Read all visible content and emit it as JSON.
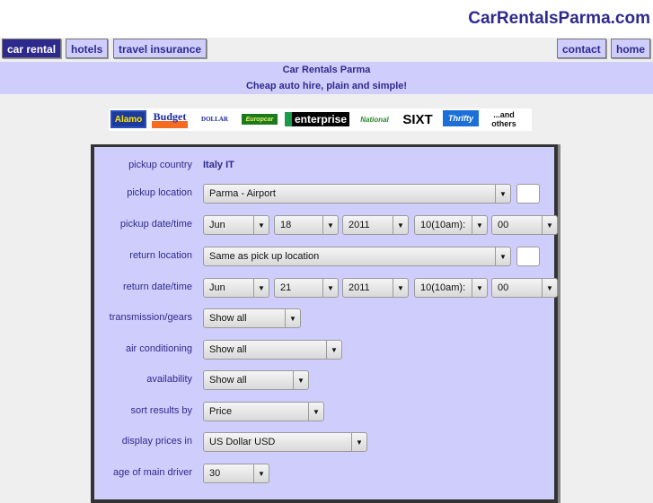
{
  "site_title": "CarRentalsParma.com",
  "nav": {
    "left": [
      {
        "label": "car rental",
        "active": true
      },
      {
        "label": "hotels",
        "active": false
      },
      {
        "label": "travel insurance",
        "active": false
      }
    ],
    "right": [
      {
        "label": "contact"
      },
      {
        "label": "home"
      }
    ]
  },
  "banner": {
    "title": "Car Rentals Parma",
    "tagline": "Cheap auto hire, plain and simple!"
  },
  "logos": [
    "Alamo",
    "Budget",
    "DOLLAR",
    "Europcar",
    "enterprise",
    "National",
    "SIXT",
    "Thrifty",
    "...and others"
  ],
  "form": {
    "pickup_country": {
      "label": "pickup country",
      "value": "Italy IT"
    },
    "pickup_location": {
      "label": "pickup location",
      "value": "Parma - Airport"
    },
    "pickup_datetime": {
      "label": "pickup date/time",
      "month": "Jun",
      "day": "18",
      "year": "2011",
      "hour": "10(10am):",
      "minute": "00"
    },
    "return_location": {
      "label": "return location",
      "value": "Same as pick up location"
    },
    "return_datetime": {
      "label": "return date/time",
      "month": "Jun",
      "day": "21",
      "year": "2011",
      "hour": "10(10am):",
      "minute": "00"
    },
    "transmission": {
      "label": "transmission/gears",
      "value": "Show all"
    },
    "air_conditioning": {
      "label": "air conditioning",
      "value": "Show all"
    },
    "availability": {
      "label": "availability",
      "value": "Show all"
    },
    "sort_by": {
      "label": "sort results by",
      "value": "Price"
    },
    "currency": {
      "label": "display prices in",
      "value": "US Dollar USD"
    },
    "driver_age": {
      "label": "age of main driver",
      "value": "30"
    }
  }
}
